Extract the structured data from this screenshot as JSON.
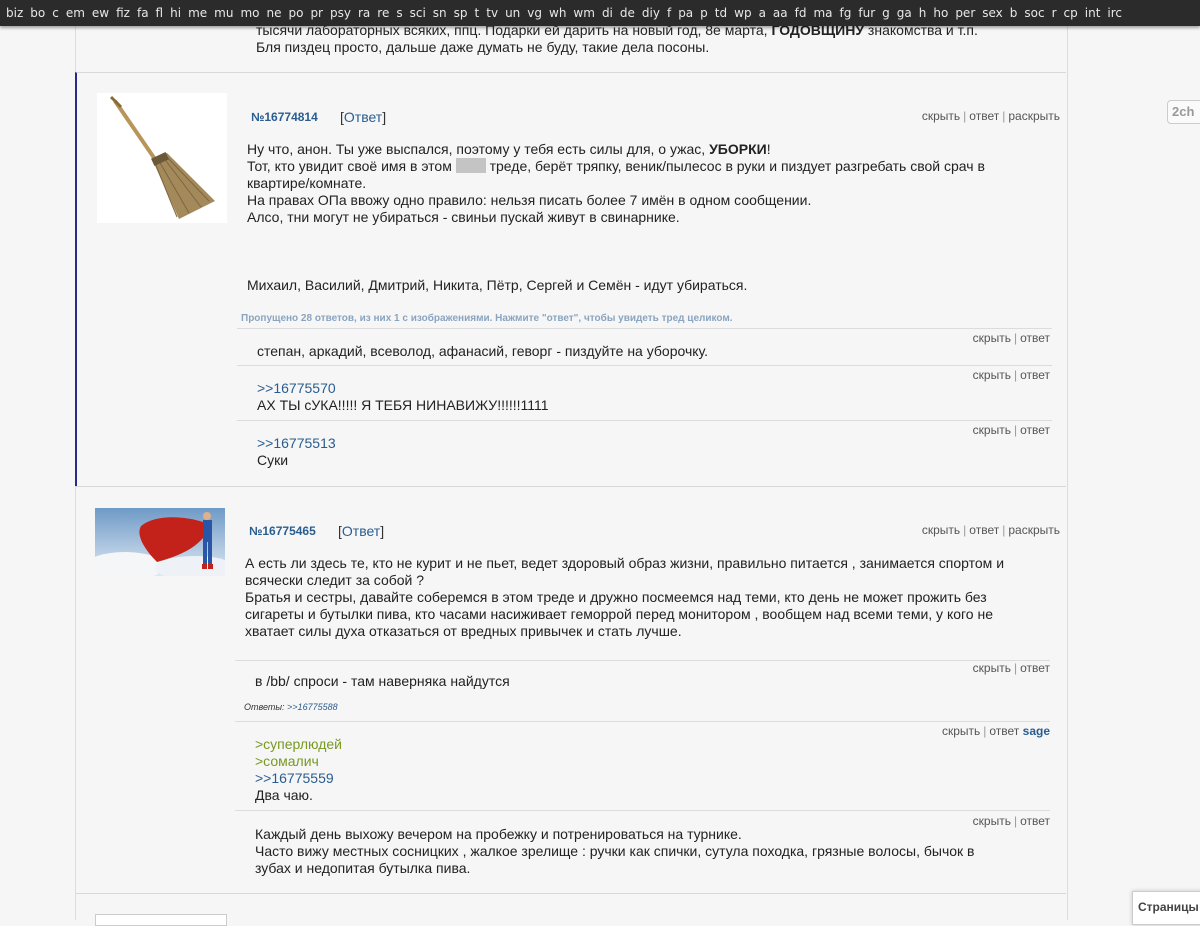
{
  "boards": [
    "biz",
    "bo",
    "c",
    "em",
    "ew",
    "fiz",
    "fa",
    "fl",
    "hi",
    "me",
    "mu",
    "mo",
    "ne",
    "po",
    "pr",
    "psy",
    "ra",
    "re",
    "s",
    "sci",
    "sn",
    "sp",
    "t",
    "tv",
    "un",
    "vg",
    "wh",
    "wm",
    "di",
    "de",
    "diy",
    "f",
    "pa",
    "p",
    "td",
    "wp",
    "a",
    "aa",
    "fd",
    "ma",
    "fg",
    "fur",
    "g",
    "ga",
    "h",
    "ho",
    "per",
    "sex",
    "b",
    "soc",
    "r",
    "cp",
    "int",
    "irc"
  ],
  "side_logo": "2ch",
  "pages_label": "Страницы",
  "prev": {
    "line1": "тысячи лабораторных всяких, ппц. Подарки ей дарить на новый год, 8е марта, ",
    "line1_bold": "ГОДОВЩИНУ",
    "line1_end": " знакомства и т.п.",
    "line2": "Бля пиздец просто, дальше даже думать не буду, такие дела посоны."
  },
  "thread1": {
    "thumb_icon": "broom-image",
    "num": "№16774814",
    "reply_open": "[",
    "reply_label": "Ответ",
    "reply_close": "]",
    "hide": "скрыть",
    "answer": "ответ",
    "expand": "раскрыть",
    "op_l1a": "Ну что, анон. Ты уже выспался, поэтому у тебя есть силы для, о ужас, ",
    "op_l1b": "УБОРКИ",
    "op_l1c": "!",
    "op_l2a": "Тот, кто увидит своё имя в этом ",
    "op_l2b": " треде, берёт тряпку, веник/пылесос в руки и пиздует разгребать свой срач в",
    "op_l3": "квартире/комнате.",
    "op_l4": "На правах ОПа ввожу одно правило: нельзя писать более 7 имён в одном сообщении.",
    "op_l5": "Алсо, тни могут не убираться - свиньи пускай живут в свинарнике.",
    "op_l6": "Михаил, Василий, Дмитрий, Никита, Пётр, Сергей и Семён - идут убираться.",
    "omitted": "Пропущено 28 ответов, из них 1 с изображениями. Нажмите \"ответ\", чтобы увидеть тред целиком.",
    "replies": [
      {
        "text": "степан, аркадий, всеволод, афанасий, геворг - пиздуйте на уборочку."
      },
      {
        "ref": ">>16775570",
        "text": "АХ ТЫ сУКА!!!!! Я ТЕБЯ НИНАВИЖУ!!!!!!1111"
      },
      {
        "ref": ">>16775513",
        "text": "Суки"
      }
    ]
  },
  "thread2": {
    "thumb_icon": "superman-image",
    "num": "№16775465",
    "reply_open": "[",
    "reply_label": "Ответ",
    "reply_close": "]",
    "hide": "скрыть",
    "answer": "ответ",
    "expand": "раскрыть",
    "op_l1": "А есть ли здесь те, кто не курит и не пьет, ведет здоровый образ жизни, правильно питается , занимается спортом и",
    "op_l2": "всячески следит за собой ?",
    "op_l3": "Братья и сестры, давайте соберемся в этом треде и дружно посмеемся над теми, кто день не может прожить без",
    "op_l4": "сигареты и бутылки пива, кто часами насиживает геморрой перед монитором , вообщем над всеми теми, у кого не",
    "op_l5": "хватает силы духа отказаться от вредных привычек и стать лучше.",
    "r1_text": "в /bb/ спроси - там наверняка найдутся",
    "r1_answers_label": "Ответы:",
    "r1_answers_ref": ">>16775588",
    "r2_q1": ">суперлюдей",
    "r2_q2": ">сомалич",
    "r2_ref": ">>16775559",
    "r2_text": "Два чаю.",
    "r2_sage": "sage",
    "r3_l1": "Каждый день выхожу вечером на пробежку и потренироваться на турнике.",
    "r3_l2": "Часто вижу местных сосницких , жалкое зрелище : ручки как спички, сутула походка, грязные волосы, бычок в",
    "r3_l3": "зубах и недопитая бутылка пива."
  }
}
